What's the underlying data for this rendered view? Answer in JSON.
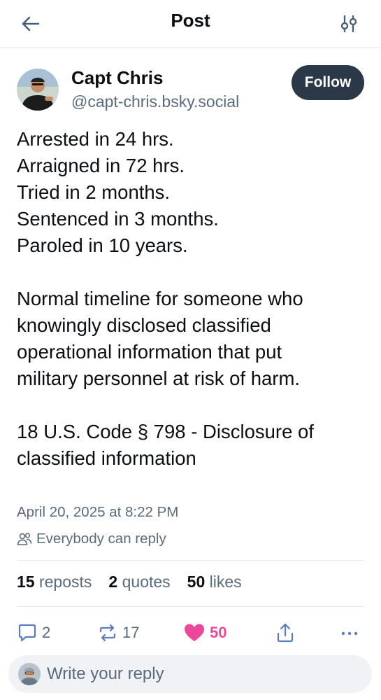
{
  "header": {
    "title": "Post"
  },
  "author": {
    "display_name": "Capt Chris",
    "handle": "@capt-chris.bsky.social",
    "follow_label": "Follow"
  },
  "post": {
    "lines_block1": [
      "Arrested in 24 hrs.",
      "Arraigned in 72 hrs.",
      "Tried in 2 months.",
      "Sentenced in 3 months.",
      "Paroled in 10 years."
    ],
    "lines_block2": [
      "Normal timeline for someone who",
      "knowingly disclosed classified",
      "operational information that put",
      "military personnel at risk of harm."
    ],
    "lines_block3": [
      "18 U.S. Code § 798 - Disclosure of",
      "classified information"
    ],
    "timestamp": "April 20, 2025 at 8:22 PM",
    "reply_setting": "Everybody can reply"
  },
  "stats": {
    "reposts_count": "15",
    "reposts_label": "reposts",
    "quotes_count": "2",
    "quotes_label": "quotes",
    "likes_count": "50",
    "likes_label": "likes"
  },
  "actions": {
    "reply_count": "2",
    "repost_count": "17",
    "like_count": "50"
  },
  "reply_bar": {
    "placeholder": "Write your reply"
  },
  "colors": {
    "like": "#ec4899",
    "follow_bg": "#2b3847",
    "muted": "#5b6b7c"
  }
}
